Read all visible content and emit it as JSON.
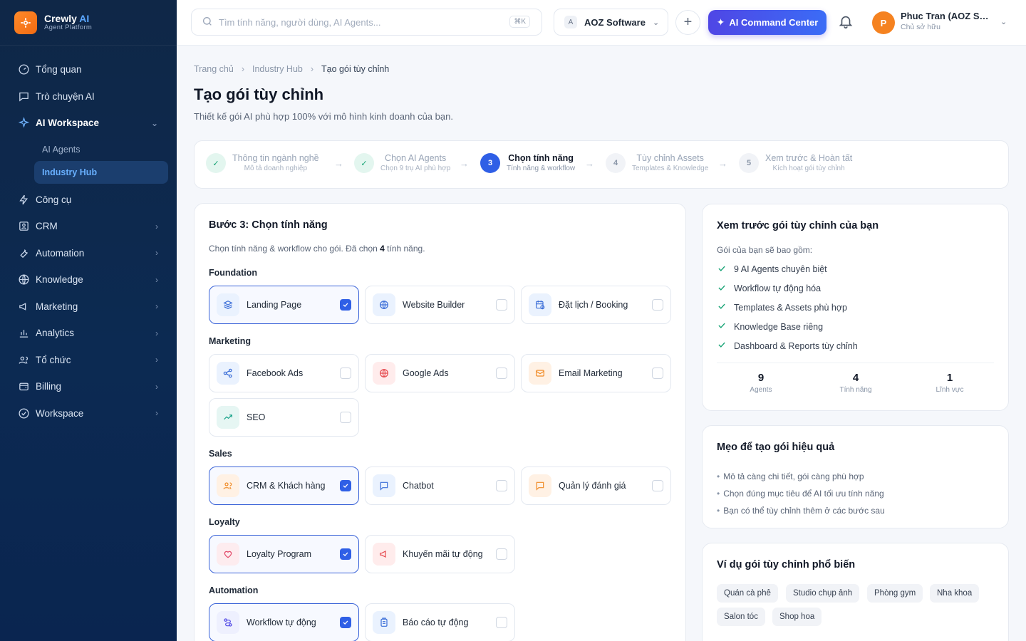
{
  "brand": {
    "name": "Crewly",
    "name_ai": "AI",
    "subtitle": "Agent Platform"
  },
  "sidebar": {
    "items": [
      {
        "label": "Tổng quan",
        "icon": "gauge-icon"
      },
      {
        "label": "Trò chuyện AI",
        "icon": "chat-icon"
      },
      {
        "label": "AI Workspace",
        "icon": "sparkle-icon",
        "expanded": true
      },
      {
        "label": "Công cụ",
        "icon": "bolt-icon"
      },
      {
        "label": "CRM",
        "icon": "contact-card-icon"
      },
      {
        "label": "Automation",
        "icon": "wrench-icon"
      },
      {
        "label": "Knowledge",
        "icon": "globe-icon"
      },
      {
        "label": "Marketing",
        "icon": "megaphone-icon"
      },
      {
        "label": "Analytics",
        "icon": "bar-chart-icon"
      },
      {
        "label": "Tổ chức",
        "icon": "users-icon"
      },
      {
        "label": "Billing",
        "icon": "wallet-icon"
      },
      {
        "label": "Workspace",
        "icon": "check-circle-icon"
      }
    ],
    "subitems": [
      {
        "label": "AI Agents",
        "active": false
      },
      {
        "label": "Industry Hub",
        "active": true
      }
    ]
  },
  "topbar": {
    "search_placeholder": "Tìm tính năng, người dùng, AI Agents...",
    "shortcut": "⌘K",
    "org_initial": "A",
    "org_name": "AOZ Software",
    "command_label": "AI Command Center",
    "user_initial": "P",
    "user_name": "Phuc Tran (AOZ Software)",
    "user_role": "Chủ sở hữu"
  },
  "breadcrumb": {
    "home": "Trang chủ",
    "parent": "Industry Hub",
    "current": "Tạo gói tùy chỉnh"
  },
  "page": {
    "title": "Tạo gói tùy chỉnh",
    "subtitle": "Thiết kế gói AI phù hợp 100% với mô hình kinh doanh của bạn."
  },
  "steps": [
    {
      "num": "1",
      "title": "Thông tin ngành nghề",
      "sub": "Mô tả doanh nghiệp",
      "state": "done"
    },
    {
      "num": "2",
      "title": "Chọn AI Agents",
      "sub": "Chọn 9 trụ AI phù hợp",
      "state": "done"
    },
    {
      "num": "3",
      "title": "Chọn tính năng",
      "sub": "Tính năng & workflow",
      "state": "current"
    },
    {
      "num": "4",
      "title": "Tùy chỉnh Assets",
      "sub": "Templates & Knowledge",
      "state": "todo"
    },
    {
      "num": "5",
      "title": "Xem trước & Hoàn tất",
      "sub": "Kích hoạt gói tùy chỉnh",
      "state": "todo"
    }
  ],
  "features": {
    "title": "Bước 3: Chọn tính năng",
    "desc_prefix": "Chọn tính năng & workflow cho gói. Đã chọn ",
    "desc_count": "4",
    "desc_suffix": " tính năng.",
    "groups": [
      {
        "label": "Foundation",
        "items": [
          {
            "label": "Landing Page",
            "icon": "layers-icon",
            "color": "blue",
            "selected": true
          },
          {
            "label": "Website Builder",
            "icon": "globe-icon",
            "color": "blue",
            "selected": false
          },
          {
            "label": "Đặt lịch / Booking",
            "icon": "calendar-clock-icon",
            "color": "blue",
            "selected": false
          }
        ]
      },
      {
        "label": "Marketing",
        "items": [
          {
            "label": "Facebook Ads",
            "icon": "share-icon",
            "color": "blue",
            "selected": false
          },
          {
            "label": "Google Ads",
            "icon": "globe-icon",
            "color": "red",
            "selected": false
          },
          {
            "label": "Email Marketing",
            "icon": "mail-icon",
            "color": "orange",
            "selected": false
          },
          {
            "label": "SEO",
            "icon": "trending-up-icon",
            "color": "teal",
            "selected": false
          }
        ]
      },
      {
        "label": "Sales",
        "items": [
          {
            "label": "CRM & Khách hàng",
            "icon": "users-icon",
            "color": "orange",
            "selected": true
          },
          {
            "label": "Chatbot",
            "icon": "chat-icon",
            "color": "blue",
            "selected": false
          },
          {
            "label": "Quản lý đánh giá",
            "icon": "chat-icon",
            "color": "orange",
            "selected": false
          }
        ]
      },
      {
        "label": "Loyalty",
        "items": [
          {
            "label": "Loyalty Program",
            "icon": "heart-hand-icon",
            "color": "pink",
            "selected": true
          },
          {
            "label": "Khuyến mãi tự động",
            "icon": "megaphone-icon",
            "color": "red",
            "selected": false
          }
        ]
      },
      {
        "label": "Automation",
        "items": [
          {
            "label": "Workflow tự động",
            "icon": "route-icon",
            "color": "indigo",
            "selected": true
          },
          {
            "label": "Báo cáo tự động",
            "icon": "clipboard-icon",
            "color": "blue",
            "selected": false
          }
        ]
      }
    ]
  },
  "preview": {
    "title": "Xem trước gói tùy chỉnh của bạn",
    "intro": "Gói của bạn sẽ bao gồm:",
    "items": [
      "9 AI Agents chuyên biệt",
      "Workflow tự động hóa",
      "Templates & Assets phù hợp",
      "Knowledge Base riêng",
      "Dashboard & Reports tùy chỉnh"
    ],
    "stats": [
      {
        "value": "9",
        "label": "Agents"
      },
      {
        "value": "4",
        "label": "Tính năng"
      },
      {
        "value": "1",
        "label": "Lĩnh vực"
      }
    ]
  },
  "tips": {
    "title": "Mẹo để tạo gói hiệu quả",
    "items": [
      "Mô tả càng chi tiết, gói càng phù hợp",
      "Chọn đúng mục tiêu để AI tối ưu tính năng",
      "Bạn có thể tùy chỉnh thêm ở các bước sau"
    ]
  },
  "examples": {
    "title": "Ví dụ gói tùy chỉnh phổ biến",
    "chips": [
      "Quán cà phê",
      "Studio chụp ảnh",
      "Phòng gym",
      "Nha khoa",
      "Salon tóc",
      "Shop hoa"
    ]
  }
}
